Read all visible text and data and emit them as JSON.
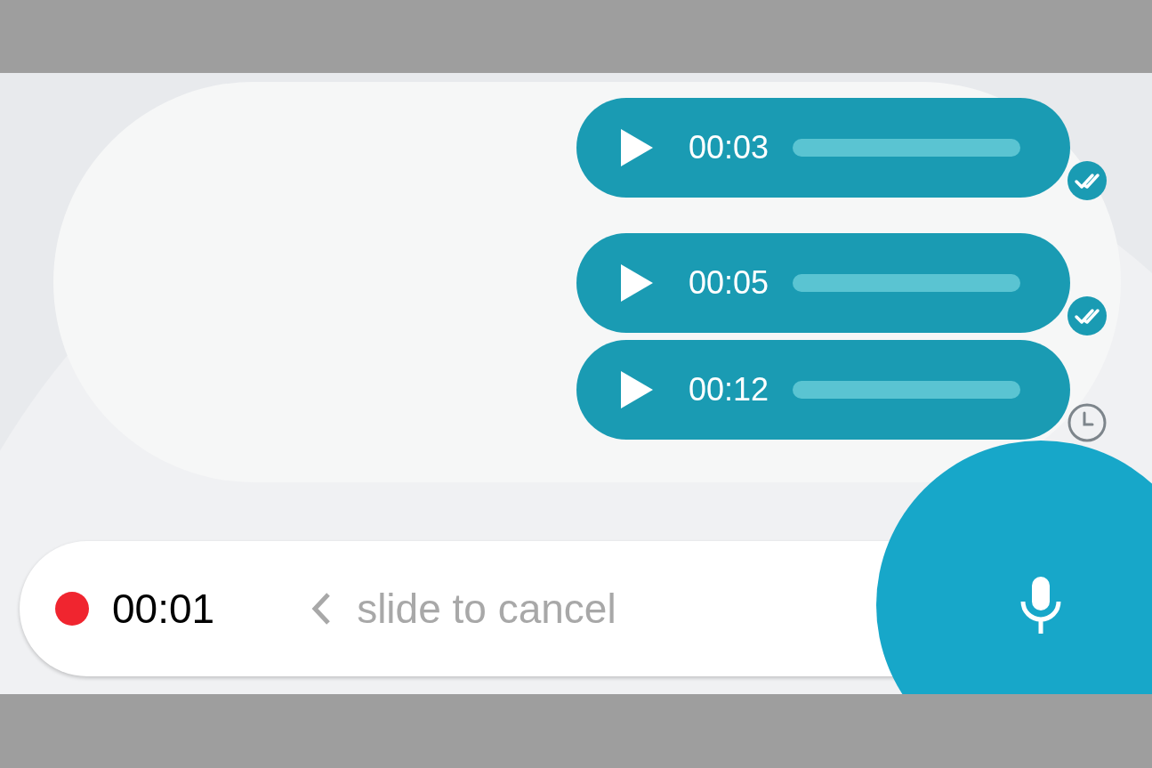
{
  "messages": [
    {
      "duration": "00:03",
      "kind": "read"
    },
    {
      "duration": "00:05",
      "kind": "read"
    },
    {
      "duration": "00:12",
      "kind": "pending"
    }
  ],
  "recorder": {
    "elapsed": "00:01",
    "hint": "slide to cancel",
    "recording": true
  }
}
